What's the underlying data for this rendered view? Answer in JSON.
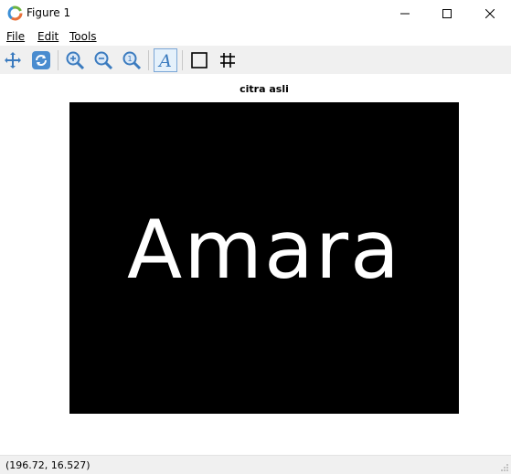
{
  "window": {
    "title": "Figure 1",
    "controls": {
      "minimize": "minimize-icon",
      "maximize": "maximize-icon",
      "close": "close-icon"
    }
  },
  "menu": {
    "items": [
      {
        "label": "File",
        "mnemonic": "F"
      },
      {
        "label": "Edit",
        "mnemonic": "E"
      },
      {
        "label": "Tools",
        "mnemonic": "T"
      }
    ]
  },
  "toolbar": {
    "buttons": [
      {
        "name": "pan",
        "icon": "move-icon"
      },
      {
        "name": "refresh",
        "icon": "refresh-icon"
      },
      {
        "name": "zoom-in",
        "icon": "zoom-in-icon"
      },
      {
        "name": "zoom-out",
        "icon": "zoom-out-icon"
      },
      {
        "name": "zoom-1-1",
        "icon": "zoom-reset-icon"
      },
      {
        "name": "text",
        "icon": "text-icon"
      },
      {
        "name": "rectangle",
        "icon": "rectangle-icon"
      },
      {
        "name": "grid",
        "icon": "grid-icon"
      }
    ]
  },
  "figure": {
    "title": "citra asli",
    "image_text": "Amara",
    "image_background": "#000000",
    "image_text_color": "#ffffff"
  },
  "status": {
    "coords": "(196.72, 16.527)"
  },
  "colors": {
    "toolbar_bg": "#f0f0f0",
    "icon_blue": "#3b7bbf"
  }
}
